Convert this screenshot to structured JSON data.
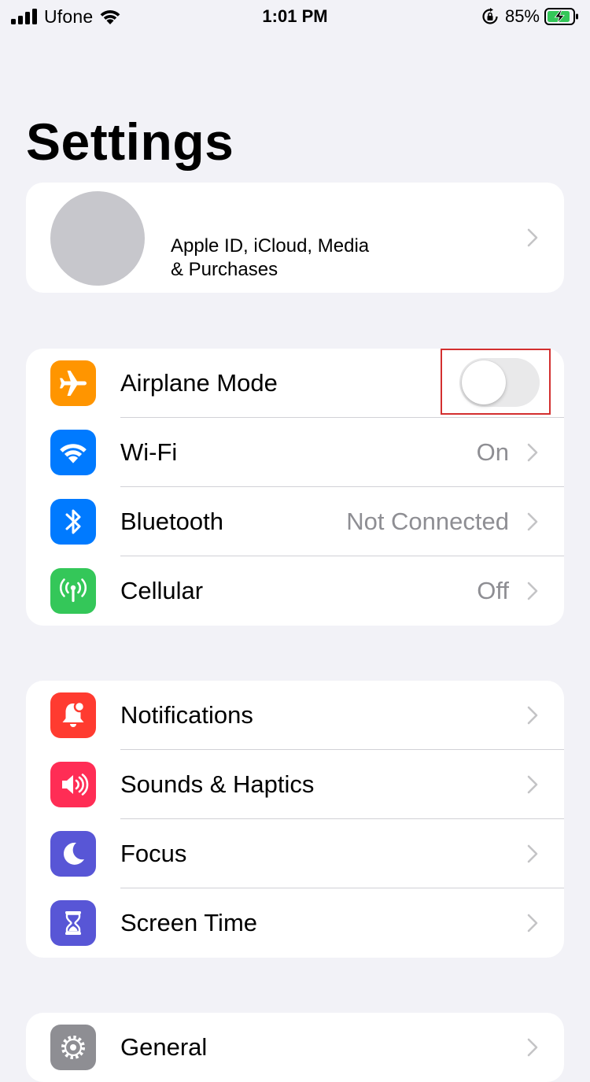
{
  "status_bar": {
    "carrier": "Ufone",
    "time": "1:01 PM",
    "battery_percent": "85%",
    "icons": [
      "signal-bars-icon",
      "wifi-icon",
      "rotation-lock-icon",
      "battery-charging-icon"
    ]
  },
  "title": "Settings",
  "profile": {
    "line1": "Apple ID, iCloud, Media",
    "line2": "& Purchases"
  },
  "connectivity": {
    "items": [
      {
        "label": "Airplane Mode",
        "icon": "airplane-icon",
        "color": "#ff9500",
        "toggle": false
      },
      {
        "label": "Wi-Fi",
        "value": "On",
        "icon": "wifi-icon",
        "color": "#007aff"
      },
      {
        "label": "Bluetooth",
        "value": "Not Connected",
        "icon": "bluetooth-icon",
        "color": "#007aff"
      },
      {
        "label": "Cellular",
        "value": "Off",
        "icon": "cellular-antenna-icon",
        "color": "#34c759"
      }
    ]
  },
  "notifications_group": {
    "items": [
      {
        "label": "Notifications",
        "icon": "bell-icon",
        "color": "#ff3b30"
      },
      {
        "label": "Sounds & Haptics",
        "icon": "speaker-icon",
        "color": "#ff2d55"
      },
      {
        "label": "Focus",
        "icon": "moon-icon",
        "color": "#5856d6"
      },
      {
        "label": "Screen Time",
        "icon": "hourglass-icon",
        "color": "#5856d6"
      }
    ]
  },
  "general_group": {
    "items": [
      {
        "label": "General",
        "icon": "gear-icon",
        "color": "#8e8e93"
      }
    ]
  },
  "colors": {
    "background": "#f2f2f7",
    "card": "#ffffff",
    "secondary_text": "#8e8e93",
    "highlight": "#d32f2f"
  }
}
